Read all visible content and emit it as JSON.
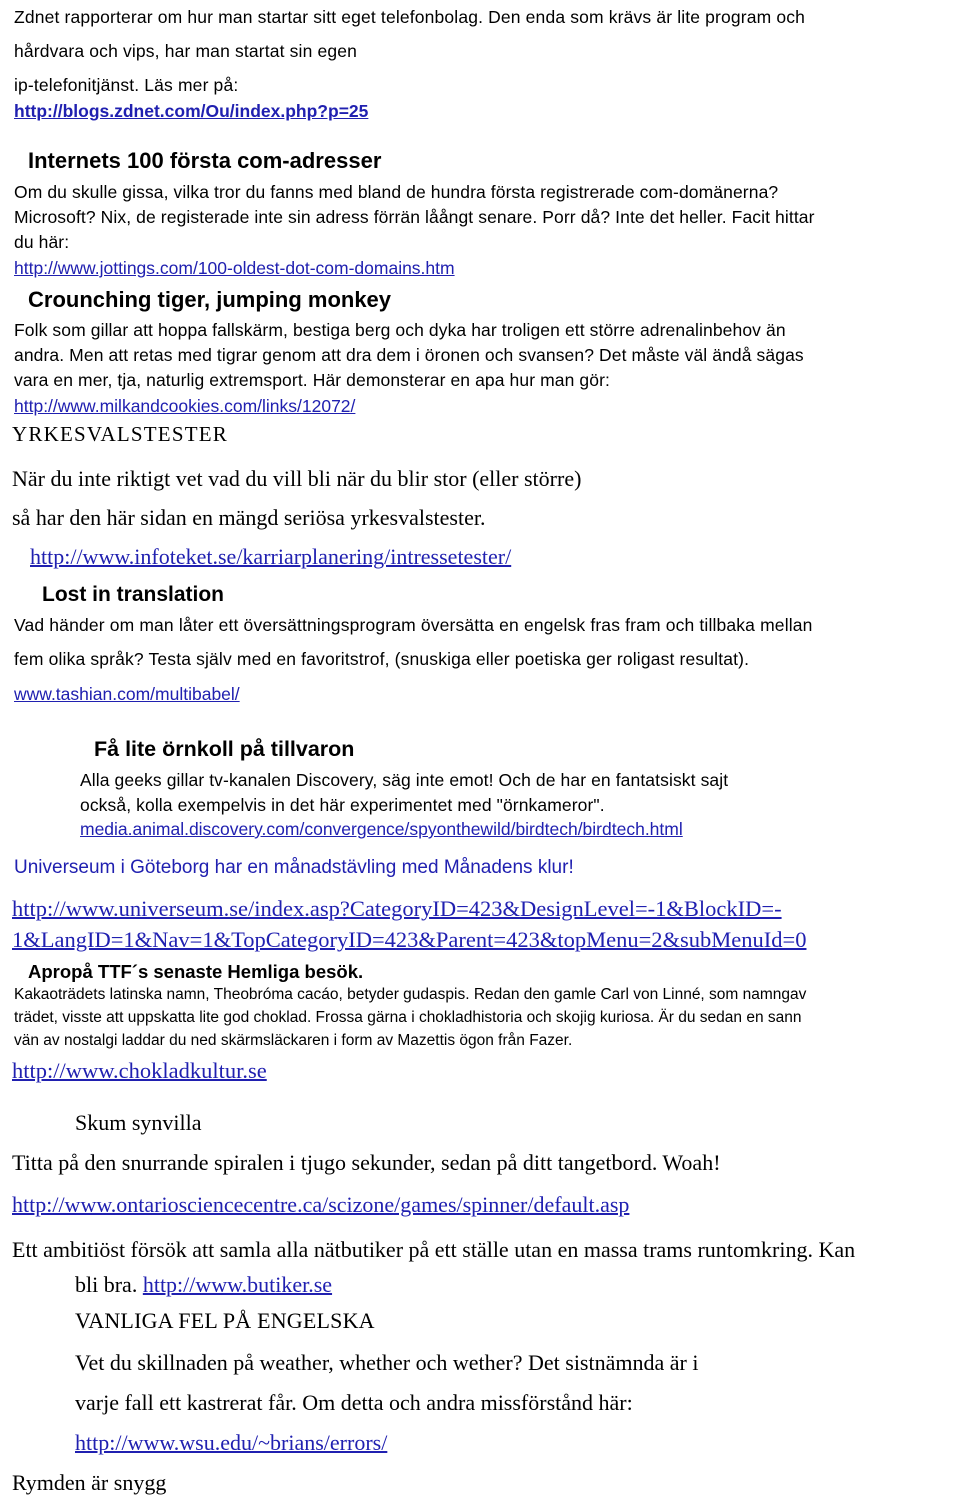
{
  "document": {
    "language": "sv",
    "link_color": "#2020b0",
    "text_color": "#000000",
    "background": "#ffffff"
  },
  "intro": {
    "line1": "Zdnet rapporterar om hur man startar sitt eget telefonbolag. Den enda som krävs är lite program och",
    "line2": "hårdvara och vips, har man startat sin egen",
    "line3": "ip-telefonitjänst. Läs mer på:",
    "link": "http://blogs.zdnet.com/Ou/index.php?p=25"
  },
  "section_com_adresser": {
    "heading": "Internets 100 första com-adresser",
    "line1": "Om du skulle gissa, vilka tror du fanns med bland de hundra första registrerade com-domänerna?",
    "line2": "Microsoft? Nix, de registerade inte sin adress förrän låångt senare. Porr då? Inte det heller. Facit hittar",
    "line3": "du här:",
    "link": "http://www.jottings.com/100-oldest-dot-com-domains.htm"
  },
  "section_crounching_tiger": {
    "heading": "Crounching tiger, jumping monkey",
    "line1": "Folk som gillar att hoppa fallskärm, bestiga berg och dyka har troligen ett större adrenalinbehov än",
    "line2": "andra. Men att retas med tigrar genom att dra dem i öronen och svansen? Det måste väl ändå sägas",
    "line3": "vara en mer, tja, naturlig extremsport. Här demonsterar en apa hur man gör:",
    "link": "http://www.milkandcookies.com/links/12072/"
  },
  "section_yrkesvalstester": {
    "heading": "YRKESVALSTESTER",
    "line1": "När du inte riktigt vet vad du vill bli när du blir stor (eller större)",
    "line2": "så har den här sidan en mängd seriösa yrkesvalstester.",
    "link": "http://www.infoteket.se/karriarplanering/intressetester/"
  },
  "section_lost_in_translation": {
    "heading": "Lost in translation",
    "line1": "Vad händer om man låter ett översättningsprogram översätta en engelsk fras fram och tillbaka mellan",
    "line2": "fem olika språk? Testa själv med en favoritstrof, (snuskiga eller poetiska ger roligast resultat).",
    "link": "www.tashian.com/multibabel/"
  },
  "section_ornkoll": {
    "heading": "Få lite örnkoll på tillvaron",
    "line1": "Alla geeks gillar tv-kanalen Discovery, säg inte emot! Och de har en fantatsiskt sajt",
    "line2": "också, kolla exempelvis in det här experimentet med \"örnkameror\".",
    "link": "media.animal.discovery.com/convergence/spyonthewild/birdtech/birdtech.html"
  },
  "section_universeum": {
    "text": "Universeum i Göteborg har en månadstävling med Månadens klur!",
    "link_line1": "http://www.universeum.se/index.asp?CategoryID=423&DesignLevel=-1&BlockID=-",
    "link_line2": "1&LangID=1&Nav=1&TopCategoryID=423&Parent=423&topMenu=2&subMenuId=0"
  },
  "section_ttf": {
    "heading": "Apropå TTF´s senaste Hemliga besök.",
    "line1": "Kakaoträdets latinska namn, Theobróma cacáo, betyder gudaspis. Redan den gamle Carl von Linné, som namngav",
    "line2": "trädet, visste att uppskatta lite god choklad. Frossa gärna i chokladhistoria och skojig kuriosa. Är du sedan en sann",
    "line3": "vän av nostalgi laddar du ned skärmsläckaren i form av Mazettis ögon från Fazer.",
    "link": "http://www.chokladkultur.se"
  },
  "section_skum_synvilla": {
    "heading": "Skum synvilla",
    "line1": "Titta på den snurrande spiralen i tjugo sekunder, sedan på ditt tangetbord. Woah!",
    "link": "http://www.ontariosciencecentre.ca/scizone/games/spinner/default.asp"
  },
  "section_butiker": {
    "line1": "Ett ambitiöst försök att samla alla nätbutiker på ett ställe utan en massa trams runtomkring. Kan",
    "line2_prefix": "bli bra. ",
    "link": "http://www.butiker.se"
  },
  "section_vanliga_fel": {
    "heading": "VANLIGA FEL PÅ ENGELSKA",
    "line1": "Vet du skillnaden på weather, whether och wether? Det sistnämnda är i",
    "line2": "varje fall ett kastrerat får. Om detta och andra missförstånd här:",
    "link": "http://www.wsu.edu/~brians/errors/"
  },
  "section_rymden": {
    "heading": "Rymden är snygg"
  }
}
